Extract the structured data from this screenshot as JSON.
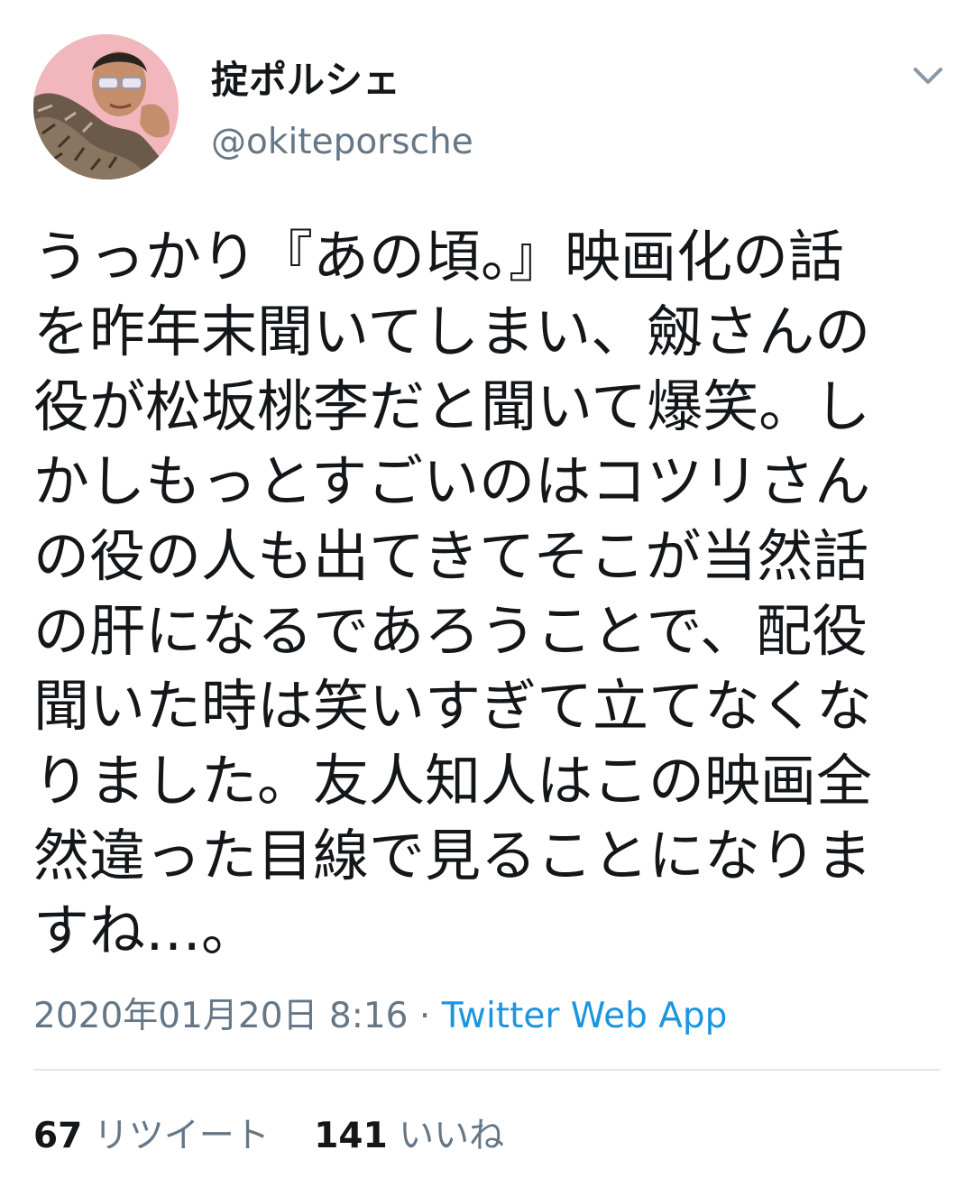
{
  "user": {
    "display_name": "掟ポルシェ",
    "handle": "@okiteporsche"
  },
  "icons": {
    "avatar": "profile-photo",
    "menu": "chevron-down-icon"
  },
  "tweet": {
    "lines": [
      "うっかり『あの頃。』映画化の話",
      "を昨年末聞いてしまい、劔さんの",
      "役が松坂桃李だと聞いて爆笑。し",
      "かしもっとすごいのはコツリさん",
      "の役の人も出てきてそこが当然話",
      "の肝になるであろうことで、配役",
      "聞いた時は笑いすぎて立てなくな",
      "りました。友人知人はこの映画全",
      "然違った目線で見ることになりま",
      "すね…。"
    ],
    "timestamp": "2020年01月20日 8:16",
    "separator": " · ",
    "source": "Twitter Web App"
  },
  "stats": {
    "retweets_count": "67",
    "retweets_label": "リツイート",
    "likes_count": "141",
    "likes_label": "いいね"
  },
  "colors": {
    "text": "#14171a",
    "secondary": "#657786",
    "link": "#1b95e0",
    "divider": "#e1e8ed"
  }
}
